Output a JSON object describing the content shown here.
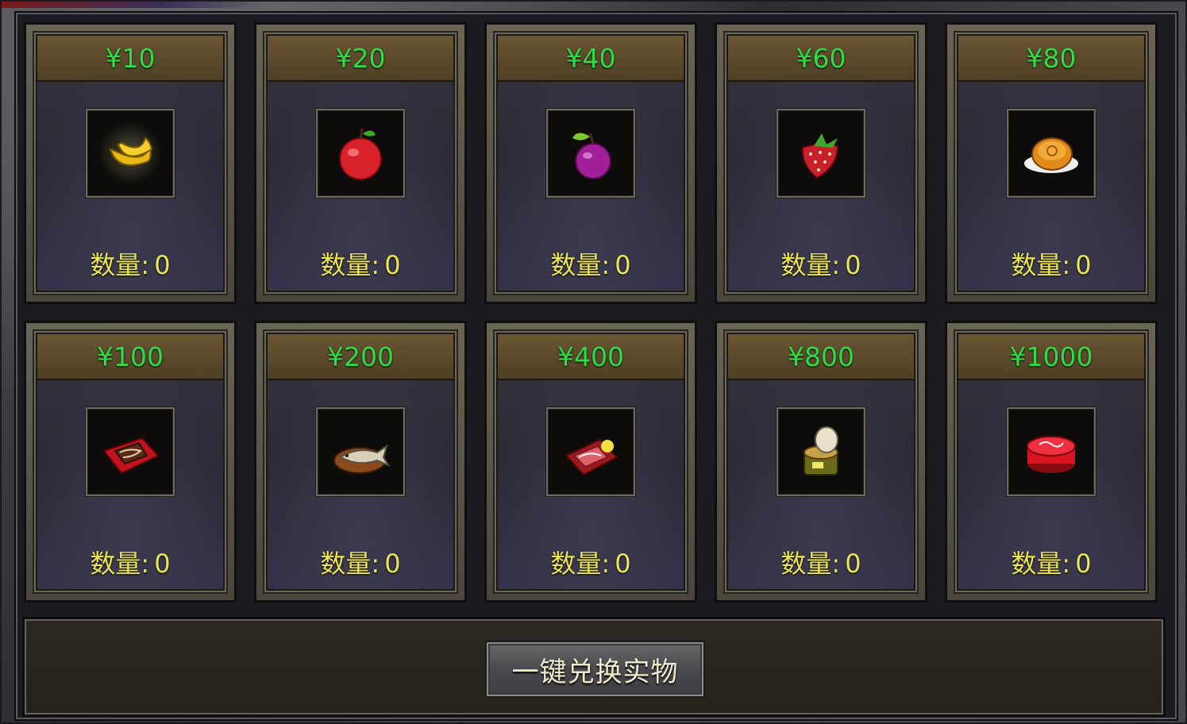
{
  "panel": {
    "items": [
      {
        "price": "¥10",
        "qty_label": "数量:",
        "qty_value": "0",
        "icon": "banana-icon"
      },
      {
        "price": "¥20",
        "qty_label": "数量:",
        "qty_value": "0",
        "icon": "apple-icon"
      },
      {
        "price": "¥40",
        "qty_label": "数量:",
        "qty_value": "0",
        "icon": "plum-icon"
      },
      {
        "price": "¥60",
        "qty_label": "数量:",
        "qty_value": "0",
        "icon": "strawberry-icon"
      },
      {
        "price": "¥80",
        "qty_label": "数量:",
        "qty_value": "0",
        "icon": "mooncake-icon"
      },
      {
        "price": "¥100",
        "qty_label": "数量:",
        "qty_value": "0",
        "icon": "chocolate-cake-icon"
      },
      {
        "price": "¥200",
        "qty_label": "数量:",
        "qty_value": "0",
        "icon": "grilled-fish-icon"
      },
      {
        "price": "¥400",
        "qty_label": "数量:",
        "qty_value": "0",
        "icon": "meat-platter-icon"
      },
      {
        "price": "¥800",
        "qty_label": "数量:",
        "qty_value": "0",
        "icon": "canned-food-icon"
      },
      {
        "price": "¥1000",
        "qty_label": "数量:",
        "qty_value": "0",
        "icon": "birthday-cake-icon"
      }
    ],
    "exchange_button": "一键兑换实物"
  },
  "colors": {
    "price_text": "#2edc48",
    "qty_text": "#ece64c",
    "button_text": "#f2eacc"
  }
}
